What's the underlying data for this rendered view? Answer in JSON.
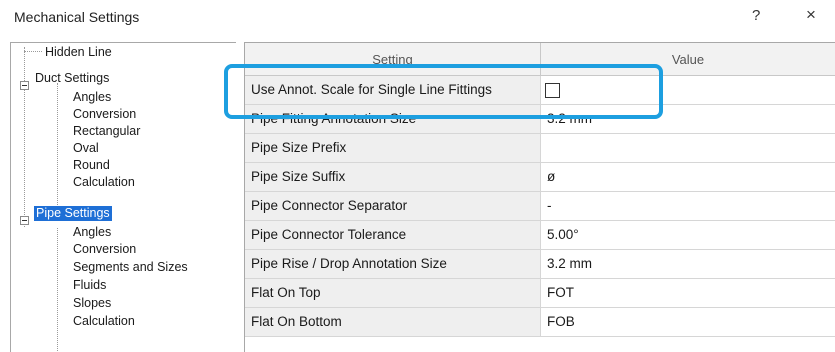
{
  "window": {
    "title": "Mechanical Settings",
    "help_glyph": "?",
    "close_glyph": "×"
  },
  "tree": {
    "hidden_line": "Hidden Line",
    "duct_settings": "Duct Settings",
    "duct_children": [
      "Angles",
      "Conversion",
      "Rectangular",
      "Oval",
      "Round",
      "Calculation"
    ],
    "pipe_settings": "Pipe Settings",
    "pipe_children": [
      "Angles",
      "Conversion",
      "Segments and Sizes",
      "Fluids",
      "Slopes",
      "Calculation"
    ]
  },
  "grid": {
    "columns": {
      "setting": "Setting",
      "value": "Value"
    },
    "rows": [
      {
        "setting": "Use Annot. Scale for Single Line Fittings",
        "value": "",
        "type": "checkbox",
        "checked": false
      },
      {
        "setting": "Pipe Fitting Annotation Size",
        "value": "3.2 mm"
      },
      {
        "setting": "Pipe Size Prefix",
        "value": ""
      },
      {
        "setting": "Pipe Size Suffix",
        "value": "ø"
      },
      {
        "setting": "Pipe Connector Separator",
        "value": "-"
      },
      {
        "setting": "Pipe Connector Tolerance",
        "value": "5.00°"
      },
      {
        "setting": "Pipe Rise / Drop Annotation Size",
        "value": "3.2 mm"
      },
      {
        "setting": "Flat On Top",
        "value": "FOT"
      },
      {
        "setting": "Flat On Bottom",
        "value": "FOB"
      }
    ]
  },
  "colors": {
    "selection": "#1e6fd6",
    "highlight": "#1d9fe0"
  }
}
